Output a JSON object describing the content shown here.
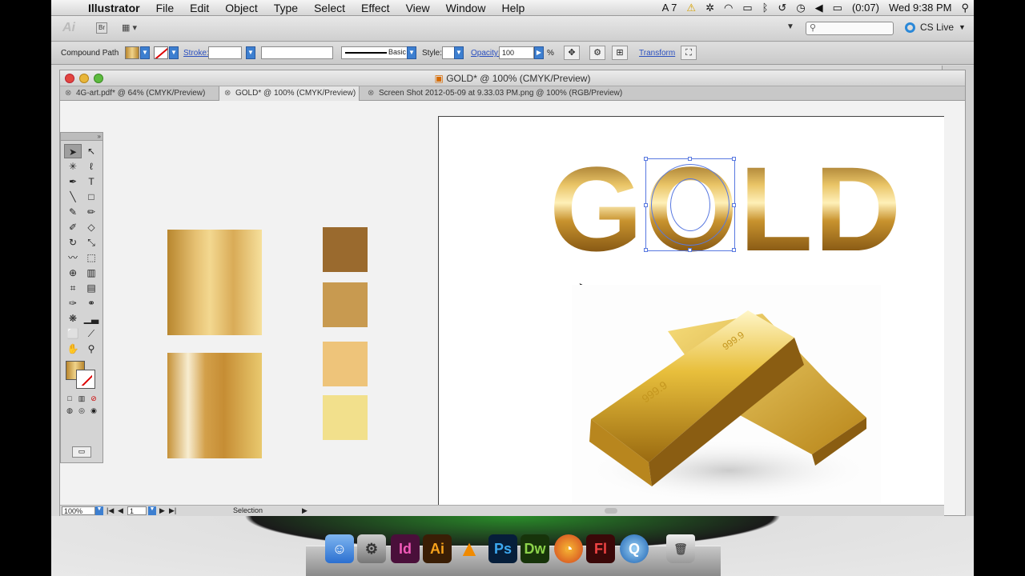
{
  "menubar": {
    "app_name": "Illustrator",
    "menus": [
      "File",
      "Edit",
      "Object",
      "Type",
      "Select",
      "Effect",
      "View",
      "Window",
      "Help"
    ],
    "status_items": [
      "A 7",
      "(0:07)",
      "Wed 9:38 PM"
    ]
  },
  "appbar": {
    "logo": "Ai",
    "bridge": "Br",
    "search_placeholder": "",
    "cs_live": "CS Live"
  },
  "control": {
    "selection_type": "Compound Path",
    "stroke_label": "Stroke:",
    "brush_label": "Basic",
    "style_label": "Style:",
    "opacity_label": "Opacity:",
    "opacity_value": "100",
    "opacity_unit": "%",
    "transform_label": "Transform"
  },
  "document": {
    "window_title": "GOLD* @ 100% (CMYK/Preview)",
    "tabs": [
      {
        "label": "4G-art.pdf* @ 64% (CMYK/Preview)",
        "active": false
      },
      {
        "label": "GOLD* @ 100% (CMYK/Preview)",
        "active": true
      },
      {
        "label": "Screen Shot 2012-05-09 at 9.33.03 PM.png @ 100% (RGB/Preview)",
        "active": false
      }
    ],
    "zoom": "100%",
    "page": "1",
    "tool_status": "Selection"
  },
  "artwork": {
    "gold_text": "GOLD",
    "swatches": [
      "#9a6a2e",
      "#c89a50",
      "#eec47a",
      "#f2e08c"
    ]
  },
  "colors": {
    "selection_blue": "#5878e0",
    "gold_dark": "#8a5b15",
    "gold_light": "#fff0b8"
  },
  "dock": {
    "apps": [
      "Finder",
      "System Preferences",
      "InDesign",
      "Illustrator",
      "VLC",
      "Photoshop",
      "Dreamweaver",
      "Firefox",
      "Flash",
      "QuickTime",
      "Trash"
    ],
    "app_labels": {
      "indesign": "Id",
      "illustrator": "Ai",
      "photoshop": "Ps",
      "dreamweaver": "Dw",
      "flash": "Fl"
    }
  }
}
